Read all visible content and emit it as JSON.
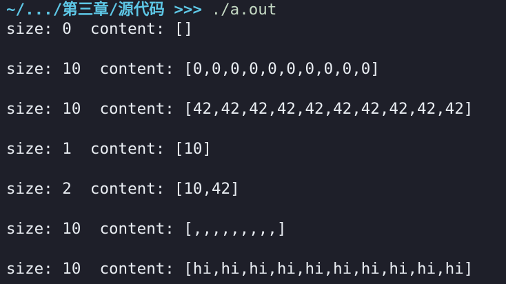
{
  "prompt": {
    "path": "~/.../第三章/源代码",
    "symbol": ">>>",
    "command": "./a.out"
  },
  "output": [
    "size: 0  content: []",
    "size: 10  content: [0,0,0,0,0,0,0,0,0,0]",
    "size: 10  content: [42,42,42,42,42,42,42,42,42,42]",
    "size: 1  content: [10]",
    "size: 2  content: [10,42]",
    "size: 10  content: [,,,,,,,,,]",
    "size: 10  content: [hi,hi,hi,hi,hi,hi,hi,hi,hi,hi]"
  ],
  "colors": {
    "background": "#1e1f29",
    "prompt_path": "#5ec7e6",
    "command": "#c5d9c4",
    "output_text": "#e9edf2"
  }
}
